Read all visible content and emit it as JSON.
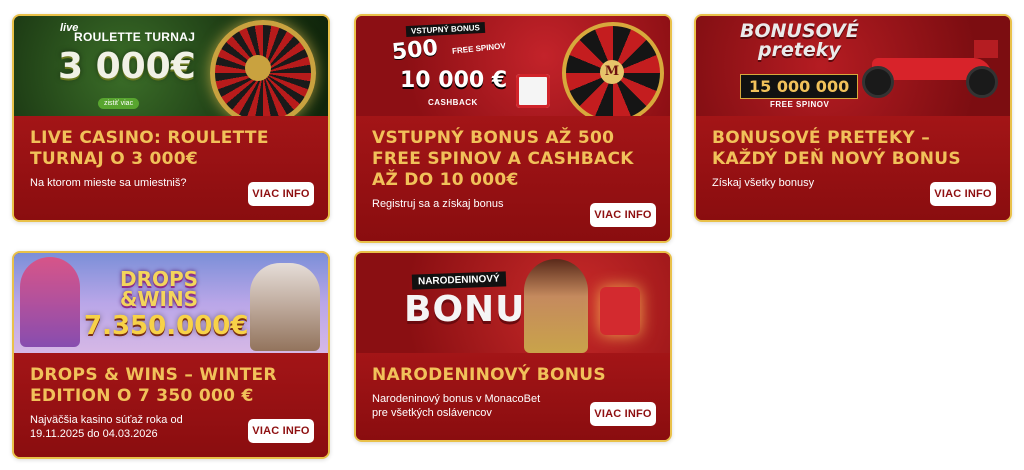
{
  "cards": [
    {
      "banner": {
        "line1": "live",
        "line2": "ROULETTE TURNAJ",
        "amount": "3 000€",
        "cta": "zistiť viac"
      },
      "title": "LIVE CASINO: ROULETTE TURNAJ O 3 000€",
      "desc": "Na ktorom mieste sa umiestniš?",
      "button": "VIAC INFO"
    },
    {
      "banner": {
        "label": "VSTUPNÝ BONUS",
        "spins": "500",
        "spins_text": "FREE SPINOV",
        "cashback": "10 000 €",
        "cashback_label": "CASHBACK",
        "logo": "M"
      },
      "title": "VSTUPNÝ BONUS AŽ 500 FREE SPINOV A CASHBACK AŽ DO 10 000€",
      "desc": "Registruj sa a získaj bonus",
      "button": "VIAC INFO"
    },
    {
      "banner": {
        "title_line1": "BONUSOVÉ",
        "title_line2": "preteky",
        "number": "15 000 000",
        "number_label": "FREE SPINOV"
      },
      "title": "BONUSOVÉ PRETEKY – KAŽDÝ DEŇ NOVÝ BONUS",
      "desc": "Získaj všetky bonusy",
      "button": "VIAC INFO"
    },
    {
      "banner": {
        "line1": "DROPS",
        "line2": "&WINS",
        "amount": "7.350.000€"
      },
      "title": "DROPS & WINS – WINTER EDITION O 7 350 000 €",
      "desc": "Najväčšia kasino súťaž roka od 19.11.2025 do 04.03.2026",
      "button": "VIAC INFO"
    },
    {
      "banner": {
        "label": "NARODENINOVÝ",
        "big": "BONUS"
      },
      "title": "NARODENINOVÝ BONUS",
      "desc": "Narodeninový bonus v MonacoBet pre všetkých oslávencov",
      "button": "VIAC INFO"
    }
  ],
  "colors": {
    "card_bg": "#8e0f10",
    "border": "#e9c14a",
    "title": "#f1c15a",
    "button_text": "#8e0f10"
  }
}
